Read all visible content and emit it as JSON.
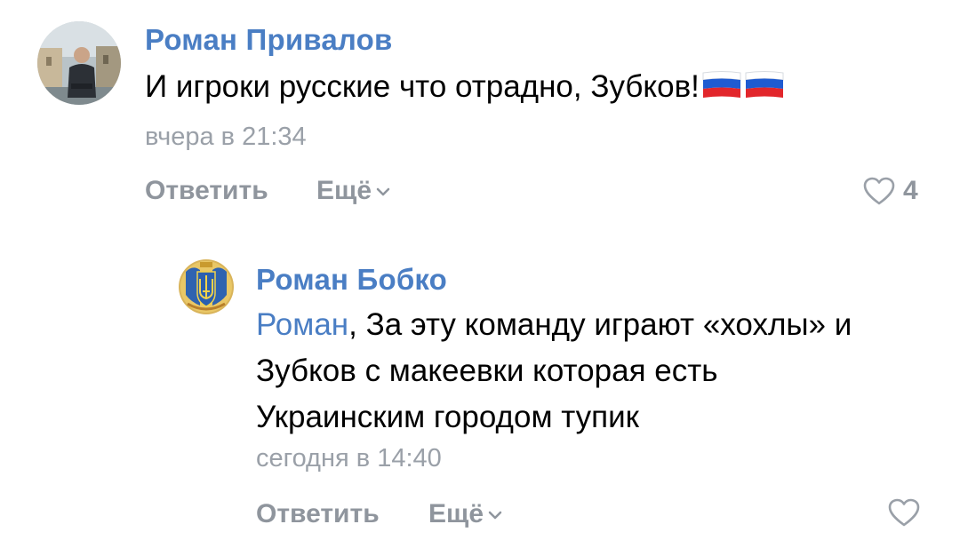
{
  "comments": [
    {
      "author": "Роман Привалов",
      "text": "И игроки русские что отрадно, Зубков!",
      "emoji": "flag-russia-icon flag-russia-icon",
      "time": "вчера в 21:34",
      "reply_label": "Ответить",
      "more_label": "Ещё",
      "likes": "4"
    },
    {
      "author": "Роман Бобко",
      "mention": "Роман",
      "text_line1": ", За эту команду играют «хохлы» и",
      "text_line2": "Зубков с макеевки которая есть",
      "text_line3": "Украинским городом тупик",
      "time": "сегодня в 14:40",
      "reply_label": "Ответить",
      "more_label": "Ещё",
      "likes": ""
    }
  ],
  "colors": {
    "accent": "#4a7ec4",
    "muted": "#9aa0a8",
    "text": "#000000"
  }
}
